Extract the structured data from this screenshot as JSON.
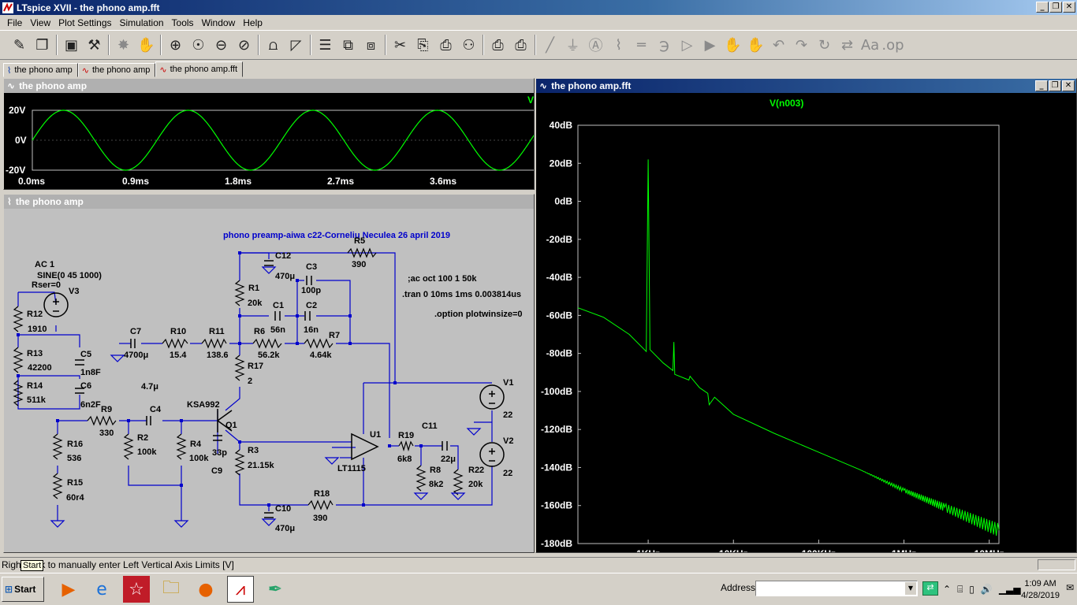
{
  "app": {
    "title": "LTspice XVII - the phono amp.fft",
    "win_min": "_",
    "win_restore": "❐",
    "win_close": "✕"
  },
  "menu": [
    "File",
    "View",
    "Plot Settings",
    "Simulation",
    "Tools",
    "Window",
    "Help"
  ],
  "toolbar_icons": [
    {
      "name": "new-schematic-icon",
      "glyph": "✎"
    },
    {
      "name": "open-folder-icon",
      "glyph": "❐"
    },
    {
      "name": "save-icon",
      "glyph": "▣"
    },
    {
      "name": "control-panel-icon",
      "glyph": "⚒"
    },
    {
      "name": "run-icon",
      "glyph": "✸",
      "dim": true
    },
    {
      "name": "halt-icon",
      "glyph": "✋",
      "dim": true
    },
    {
      "name": "zoom-in-icon",
      "glyph": "⊕"
    },
    {
      "name": "zoom-pan-icon",
      "glyph": "☉"
    },
    {
      "name": "zoom-out-icon",
      "glyph": "⊖"
    },
    {
      "name": "zoom-full-icon",
      "glyph": "⊘"
    },
    {
      "name": "autorange-icon",
      "glyph": "⩍"
    },
    {
      "name": "pick-icon",
      "glyph": "◸"
    },
    {
      "name": "tile-horizontal-icon",
      "glyph": "☰"
    },
    {
      "name": "cascade-icon",
      "glyph": "⧉"
    },
    {
      "name": "tile-vertical-icon",
      "glyph": "⧈"
    },
    {
      "name": "cut-icon",
      "glyph": "✂"
    },
    {
      "name": "copy-icon",
      "glyph": "⎘"
    },
    {
      "name": "paste-icon",
      "glyph": "⎙"
    },
    {
      "name": "find-icon",
      "glyph": "⚇"
    },
    {
      "name": "print-icon",
      "glyph": "⎙"
    },
    {
      "name": "print-setup-icon",
      "glyph": "⎙"
    },
    {
      "name": "wire-icon",
      "glyph": "╱",
      "dim": true
    },
    {
      "name": "ground-icon",
      "glyph": "⏚",
      "dim": true
    },
    {
      "name": "label-icon",
      "glyph": "Ⓐ",
      "dim": true
    },
    {
      "name": "resistor-icon",
      "glyph": "⌇",
      "dim": true
    },
    {
      "name": "capacitor-icon",
      "glyph": "═",
      "dim": true
    },
    {
      "name": "inductor-icon",
      "glyph": "℈",
      "dim": true
    },
    {
      "name": "diode-icon",
      "glyph": "▷",
      "dim": true
    },
    {
      "name": "component-icon",
      "glyph": "▶",
      "dim": true
    },
    {
      "name": "move-icon",
      "glyph": "✋",
      "dim": true
    },
    {
      "name": "drag-icon",
      "glyph": "✋",
      "dim": true
    },
    {
      "name": "undo-icon",
      "glyph": "↶",
      "dim": true
    },
    {
      "name": "redo-icon",
      "glyph": "↷",
      "dim": true
    },
    {
      "name": "rotate-icon",
      "glyph": "↻",
      "dim": true
    },
    {
      "name": "mirror-icon",
      "glyph": "⇄",
      "dim": true
    },
    {
      "name": "text-icon",
      "glyph": "Aa",
      "dim": true
    },
    {
      "name": "spice-directive-icon",
      "glyph": ".op",
      "dim": true
    }
  ],
  "tabs": [
    {
      "label": "the phono amp",
      "icon": "schematic-icon"
    },
    {
      "label": "the phono amp",
      "icon": "waveform-icon"
    },
    {
      "label": "the phono amp.fft",
      "icon": "waveform-icon"
    }
  ],
  "transient_window": {
    "title": "the phono amp",
    "trace_label": "V",
    "y_ticks": [
      "20V",
      "0V",
      "-20V"
    ],
    "x_ticks": [
      "0.0ms",
      "0.9ms",
      "1.8ms",
      "2.7ms",
      "3.6ms"
    ],
    "trace_color": "#00ff00"
  },
  "schematic_window": {
    "title": "the phono amp",
    "heading": "phono preamp-aiwa c22-Corneliu Neculea 26 april 2019",
    "directives": [
      ";ac oct 100 1 50k",
      ".tran 0 10ms 1ms 0.003814us",
      ".option plotwinsize=0"
    ],
    "source": [
      "AC 1",
      "SINE(0 45 1000)",
      "Rser=0"
    ],
    "labels": {
      "V3": "V3",
      "R12": "R12",
      "R12v": "1910",
      "R13": "R13",
      "R13v": "42200",
      "R14": "R14",
      "R14v": "511k",
      "C5": "C5",
      "C5v": "1n8F",
      "C6": "C6",
      "C6v": "6n2F",
      "R9": "R9",
      "R9v": "330",
      "C4": "C4",
      "C4v": "4.7μ",
      "R2": "R2",
      "R2v": "100k",
      "R4": "R4",
      "R4v": "100k",
      "R16": "R16",
      "R16v": "536",
      "R15": "R15",
      "R15v": "60r4",
      "C7": "C7",
      "C7v": "4700μ",
      "R10": "R10",
      "R10v": "15.4",
      "R11": "R11",
      "R11v": "138.6",
      "R6": "R6",
      "R6v": "56.2k",
      "R7": "R7",
      "R7v": "4.64k",
      "C1": "C1",
      "C1v": "56n",
      "C2": "C2",
      "C2v": "16n",
      "C3": "C3",
      "C3v": "100p",
      "C12": "C12",
      "C12v": "470μ",
      "R1": "R1",
      "R1v": "20k",
      "R5": "R5",
      "R5v": "390",
      "R17": "R17",
      "R17v": "2",
      "Q1": "Q1",
      "KSA": "KSA992",
      "C9": "C9",
      "C9v": "33p",
      "R3": "R3",
      "R3v": "21.15k",
      "U1": "U1",
      "LT": "LT1115",
      "R19": "R19",
      "R19v": "6k8",
      "C11": "C11",
      "C11v": "22μ",
      "R8": "R8",
      "R8v": "8k2",
      "R22": "R22",
      "R22v": "20k",
      "V1": "V1",
      "V1v": "22",
      "V2": "V2",
      "V2v": "22",
      "R18": "R18",
      "R18v": "390",
      "C10": "C10",
      "C10v": "470μ"
    }
  },
  "fft_window": {
    "title": "the phono amp.fft",
    "trace_label": "V(n003)",
    "y_ticks": [
      "40dB",
      "20dB",
      "0dB",
      "-20dB",
      "-40dB",
      "-60dB",
      "-80dB",
      "-100dB",
      "-120dB",
      "-140dB",
      "-160dB",
      "-180dB"
    ],
    "x_ticks": [
      "1KHz",
      "10KHz",
      "100KHz",
      "1MHz",
      "10MHz"
    ]
  },
  "chart_data": [
    {
      "type": "line",
      "title": "",
      "series": [
        {
          "name": "V",
          "x_ms": [
            0,
            0.45,
            0.9,
            1.35,
            1.8,
            2.25,
            2.7,
            3.15,
            3.6,
            4.05
          ],
          "amplitude_V": 20,
          "frequency_hz": 1000
        }
      ],
      "xlabel": "",
      "ylabel": "",
      "xlim_ms": [
        0,
        4.05
      ],
      "ylim": [
        -20,
        20
      ]
    },
    {
      "type": "line",
      "title": "",
      "xscale": "log",
      "xlim_hz": [
        150,
        13000000
      ],
      "ylim_db": [
        -180,
        40
      ],
      "series": [
        {
          "name": "V(n003)",
          "x_hz": [
            150,
            300,
            600,
            950,
            1000,
            1050,
            1500,
            1950,
            2000,
            2050,
            3000,
            3100,
            4000,
            5000,
            5200,
            6000,
            10000,
            30000,
            100000,
            300000,
            1000000,
            3000000,
            13000000
          ],
          "y_db": [
            -56,
            -61,
            -70,
            -79,
            22,
            -78,
            -85,
            -89,
            -74,
            -91,
            -94,
            -92,
            -98,
            -101,
            -107,
            -103,
            -112,
            -122,
            -132,
            -141,
            -152,
            -161,
            -173
          ]
        }
      ]
    }
  ],
  "status": {
    "text": "Right-click to manually enter Left Vertical Axis Limits [V]",
    "tooltip": "Start"
  },
  "taskbar": {
    "start": "Start",
    "address_label": "Address",
    "time": "1:09 AM",
    "date": "4/28/2019"
  }
}
